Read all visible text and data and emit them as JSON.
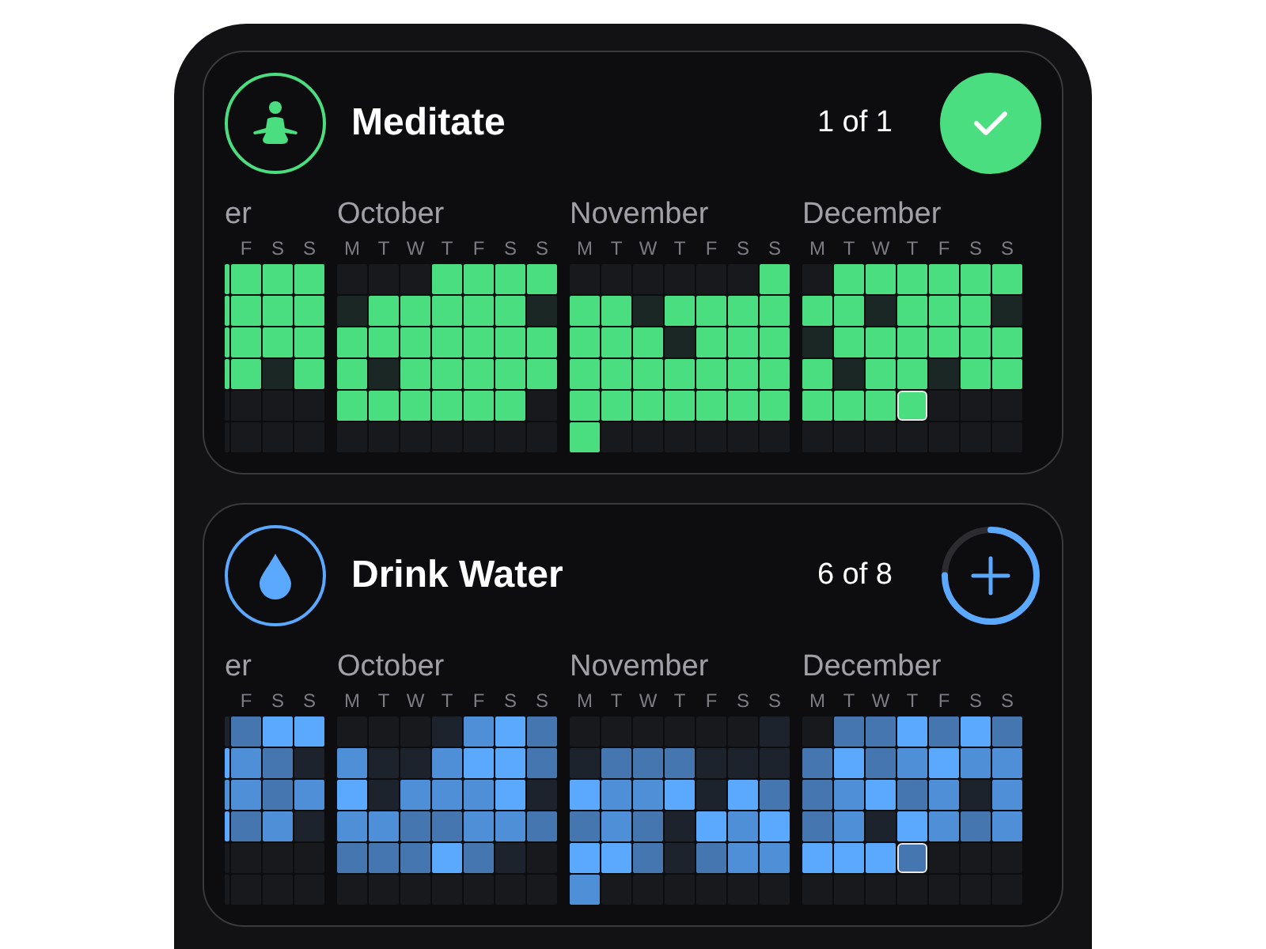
{
  "habits": [
    {
      "title": "Meditate",
      "count": "1 of 1",
      "completed": true,
      "color": "#4ade80",
      "months": [
        {
          "name": "er",
          "kind": "partial",
          "days": [
            "F",
            "S",
            "S"
          ],
          "weeks": [
            [
              {
                "kind": "done"
              },
              {
                "kind": "done"
              },
              {
                "kind": "done"
              },
              {
                "kind": "done"
              }
            ],
            [
              {
                "kind": "done"
              },
              {
                "kind": "done"
              },
              {
                "kind": "done"
              },
              {
                "kind": "done"
              }
            ],
            [
              {
                "kind": "done"
              },
              {
                "kind": "done"
              },
              {
                "kind": "done"
              },
              {
                "kind": "done"
              }
            ],
            [
              {
                "kind": "done"
              },
              {
                "kind": "done"
              },
              {
                "kind": "missed"
              },
              {
                "kind": "done"
              }
            ],
            [
              {
                "kind": "blank"
              },
              {
                "kind": "blank"
              },
              {
                "kind": "blank"
              },
              {
                "kind": "blank"
              }
            ],
            [
              {
                "kind": "blank"
              },
              {
                "kind": "blank"
              },
              {
                "kind": "blank"
              },
              {
                "kind": "blank"
              }
            ]
          ]
        },
        {
          "name": "October",
          "kind": "full",
          "days": [
            "M",
            "T",
            "W",
            "T",
            "F",
            "S",
            "S"
          ],
          "weeks": [
            [
              {
                "kind": "blank"
              },
              {
                "kind": "blank"
              },
              {
                "kind": "blank"
              },
              {
                "kind": "done"
              },
              {
                "kind": "done"
              },
              {
                "kind": "done"
              },
              {
                "kind": "done"
              }
            ],
            [
              {
                "kind": "missed"
              },
              {
                "kind": "done"
              },
              {
                "kind": "done"
              },
              {
                "kind": "done"
              },
              {
                "kind": "done"
              },
              {
                "kind": "done"
              },
              {
                "kind": "missed"
              }
            ],
            [
              {
                "kind": "done"
              },
              {
                "kind": "done"
              },
              {
                "kind": "done"
              },
              {
                "kind": "done"
              },
              {
                "kind": "done"
              },
              {
                "kind": "done"
              },
              {
                "kind": "done"
              }
            ],
            [
              {
                "kind": "done"
              },
              {
                "kind": "missed"
              },
              {
                "kind": "done"
              },
              {
                "kind": "done"
              },
              {
                "kind": "done"
              },
              {
                "kind": "done"
              },
              {
                "kind": "done"
              }
            ],
            [
              {
                "kind": "done"
              },
              {
                "kind": "done"
              },
              {
                "kind": "done"
              },
              {
                "kind": "done"
              },
              {
                "kind": "done"
              },
              {
                "kind": "done"
              },
              {
                "kind": "blank"
              }
            ],
            [
              {
                "kind": "blank"
              },
              {
                "kind": "blank"
              },
              {
                "kind": "blank"
              },
              {
                "kind": "blank"
              },
              {
                "kind": "blank"
              },
              {
                "kind": "blank"
              },
              {
                "kind": "blank"
              }
            ]
          ]
        },
        {
          "name": "November",
          "kind": "full",
          "days": [
            "M",
            "T",
            "W",
            "T",
            "F",
            "S",
            "S"
          ],
          "weeks": [
            [
              {
                "kind": "blank"
              },
              {
                "kind": "blank"
              },
              {
                "kind": "blank"
              },
              {
                "kind": "blank"
              },
              {
                "kind": "blank"
              },
              {
                "kind": "blank"
              },
              {
                "kind": "done"
              }
            ],
            [
              {
                "kind": "done"
              },
              {
                "kind": "done"
              },
              {
                "kind": "missed"
              },
              {
                "kind": "done"
              },
              {
                "kind": "done"
              },
              {
                "kind": "done"
              },
              {
                "kind": "done"
              }
            ],
            [
              {
                "kind": "done"
              },
              {
                "kind": "done"
              },
              {
                "kind": "done"
              },
              {
                "kind": "missed"
              },
              {
                "kind": "done"
              },
              {
                "kind": "done"
              },
              {
                "kind": "done"
              }
            ],
            [
              {
                "kind": "done"
              },
              {
                "kind": "done"
              },
              {
                "kind": "done"
              },
              {
                "kind": "done"
              },
              {
                "kind": "done"
              },
              {
                "kind": "done"
              },
              {
                "kind": "done"
              }
            ],
            [
              {
                "kind": "done"
              },
              {
                "kind": "done"
              },
              {
                "kind": "done"
              },
              {
                "kind": "done"
              },
              {
                "kind": "done"
              },
              {
                "kind": "done"
              },
              {
                "kind": "done"
              }
            ],
            [
              {
                "kind": "done"
              },
              {
                "kind": "blank"
              },
              {
                "kind": "blank"
              },
              {
                "kind": "blank"
              },
              {
                "kind": "blank"
              },
              {
                "kind": "blank"
              },
              {
                "kind": "blank"
              }
            ]
          ]
        },
        {
          "name": "December",
          "kind": "full",
          "days": [
            "M",
            "T",
            "W",
            "T",
            "F",
            "S",
            "S"
          ],
          "weeks": [
            [
              {
                "kind": "blank"
              },
              {
                "kind": "done"
              },
              {
                "kind": "done"
              },
              {
                "kind": "done"
              },
              {
                "kind": "done"
              },
              {
                "kind": "done"
              },
              {
                "kind": "done"
              }
            ],
            [
              {
                "kind": "done"
              },
              {
                "kind": "done"
              },
              {
                "kind": "missed"
              },
              {
                "kind": "done"
              },
              {
                "kind": "done"
              },
              {
                "kind": "done"
              },
              {
                "kind": "missed"
              }
            ],
            [
              {
                "kind": "missed"
              },
              {
                "kind": "done"
              },
              {
                "kind": "done"
              },
              {
                "kind": "done"
              },
              {
                "kind": "done"
              },
              {
                "kind": "done"
              },
              {
                "kind": "done"
              }
            ],
            [
              {
                "kind": "done"
              },
              {
                "kind": "missed"
              },
              {
                "kind": "done"
              },
              {
                "kind": "done"
              },
              {
                "kind": "missed"
              },
              {
                "kind": "done"
              },
              {
                "kind": "done"
              }
            ],
            [
              {
                "kind": "done"
              },
              {
                "kind": "done"
              },
              {
                "kind": "done"
              },
              {
                "kind": "done",
                "today": true
              },
              {
                "kind": "blank"
              },
              {
                "kind": "blank"
              },
              {
                "kind": "blank"
              }
            ],
            [
              {
                "kind": "blank"
              },
              {
                "kind": "blank"
              },
              {
                "kind": "blank"
              },
              {
                "kind": "blank"
              },
              {
                "kind": "blank"
              },
              {
                "kind": "blank"
              },
              {
                "kind": "blank"
              }
            ]
          ]
        }
      ]
    },
    {
      "title": "Drink Water",
      "count": "6 of 8",
      "completed": false,
      "color": "#5ba8ff",
      "months": [
        {
          "name": "er",
          "kind": "partial",
          "days": [
            "F",
            "S",
            "S"
          ],
          "weeks": [
            [
              {
                "kind": "missed"
              },
              {
                "kind": "done",
                "color": "#4676b0"
              },
              {
                "kind": "done",
                "color": "#5ba8ff"
              },
              {
                "kind": "done",
                "color": "#5ba8ff"
              }
            ],
            [
              {
                "kind": "done",
                "color": "#5ba8ff"
              },
              {
                "kind": "done",
                "color": "#4f8fd8"
              },
              {
                "kind": "done",
                "color": "#4676b0"
              },
              {
                "kind": "missed"
              }
            ],
            [
              {
                "kind": "done",
                "color": "#4f8fd8"
              },
              {
                "kind": "done",
                "color": "#4f8fd8"
              },
              {
                "kind": "done",
                "color": "#4676b0"
              },
              {
                "kind": "done",
                "color": "#4f8fd8"
              }
            ],
            [
              {
                "kind": "done",
                "color": "#5ba8ff"
              },
              {
                "kind": "done",
                "color": "#4676b0"
              },
              {
                "kind": "done",
                "color": "#4f8fd8"
              },
              {
                "kind": "missed"
              }
            ],
            [
              {
                "kind": "blank"
              },
              {
                "kind": "blank"
              },
              {
                "kind": "blank"
              },
              {
                "kind": "blank"
              }
            ],
            [
              {
                "kind": "blank"
              },
              {
                "kind": "blank"
              },
              {
                "kind": "blank"
              },
              {
                "kind": "blank"
              }
            ]
          ]
        },
        {
          "name": "October",
          "kind": "full",
          "days": [
            "M",
            "T",
            "W",
            "T",
            "F",
            "S",
            "S"
          ],
          "weeks": [
            [
              {
                "kind": "blank"
              },
              {
                "kind": "blank"
              },
              {
                "kind": "blank"
              },
              {
                "kind": "missed"
              },
              {
                "kind": "done",
                "color": "#4f8fd8"
              },
              {
                "kind": "done",
                "color": "#5ba8ff"
              },
              {
                "kind": "done",
                "color": "#4676b0"
              }
            ],
            [
              {
                "kind": "done",
                "color": "#4f8fd8"
              },
              {
                "kind": "missed"
              },
              {
                "kind": "missed"
              },
              {
                "kind": "done",
                "color": "#4f8fd8"
              },
              {
                "kind": "done",
                "color": "#5ba8ff"
              },
              {
                "kind": "done",
                "color": "#5ba8ff"
              },
              {
                "kind": "done",
                "color": "#4676b0"
              }
            ],
            [
              {
                "kind": "done",
                "color": "#5ba8ff"
              },
              {
                "kind": "missed"
              },
              {
                "kind": "done",
                "color": "#4f8fd8"
              },
              {
                "kind": "done",
                "color": "#4f8fd8"
              },
              {
                "kind": "done",
                "color": "#4f8fd8"
              },
              {
                "kind": "done",
                "color": "#5ba8ff"
              },
              {
                "kind": "missed"
              }
            ],
            [
              {
                "kind": "done",
                "color": "#4f8fd8"
              },
              {
                "kind": "done",
                "color": "#4f8fd8"
              },
              {
                "kind": "done",
                "color": "#4676b0"
              },
              {
                "kind": "done",
                "color": "#4676b0"
              },
              {
                "kind": "done",
                "color": "#4f8fd8"
              },
              {
                "kind": "done",
                "color": "#4f8fd8"
              },
              {
                "kind": "done",
                "color": "#4676b0"
              }
            ],
            [
              {
                "kind": "done",
                "color": "#4676b0"
              },
              {
                "kind": "done",
                "color": "#4676b0"
              },
              {
                "kind": "done",
                "color": "#4676b0"
              },
              {
                "kind": "done",
                "color": "#5ba8ff"
              },
              {
                "kind": "done",
                "color": "#4676b0"
              },
              {
                "kind": "missed"
              },
              {
                "kind": "blank"
              }
            ],
            [
              {
                "kind": "blank"
              },
              {
                "kind": "blank"
              },
              {
                "kind": "blank"
              },
              {
                "kind": "blank"
              },
              {
                "kind": "blank"
              },
              {
                "kind": "blank"
              },
              {
                "kind": "blank"
              }
            ]
          ]
        },
        {
          "name": "November",
          "kind": "full",
          "days": [
            "M",
            "T",
            "W",
            "T",
            "F",
            "S",
            "S"
          ],
          "weeks": [
            [
              {
                "kind": "blank"
              },
              {
                "kind": "blank"
              },
              {
                "kind": "blank"
              },
              {
                "kind": "blank"
              },
              {
                "kind": "blank"
              },
              {
                "kind": "blank"
              },
              {
                "kind": "missed"
              }
            ],
            [
              {
                "kind": "missed"
              },
              {
                "kind": "done",
                "color": "#4676b0"
              },
              {
                "kind": "done",
                "color": "#4676b0"
              },
              {
                "kind": "done",
                "color": "#4676b0"
              },
              {
                "kind": "missed"
              },
              {
                "kind": "missed"
              },
              {
                "kind": "missed"
              }
            ],
            [
              {
                "kind": "done",
                "color": "#5ba8ff"
              },
              {
                "kind": "done",
                "color": "#4f8fd8"
              },
              {
                "kind": "done",
                "color": "#4f8fd8"
              },
              {
                "kind": "done",
                "color": "#5ba8ff"
              },
              {
                "kind": "missed"
              },
              {
                "kind": "done",
                "color": "#5ba8ff"
              },
              {
                "kind": "done",
                "color": "#4676b0"
              }
            ],
            [
              {
                "kind": "done",
                "color": "#4676b0"
              },
              {
                "kind": "done",
                "color": "#4f8fd8"
              },
              {
                "kind": "done",
                "color": "#4676b0"
              },
              {
                "kind": "missed"
              },
              {
                "kind": "done",
                "color": "#5ba8ff"
              },
              {
                "kind": "done",
                "color": "#4f8fd8"
              },
              {
                "kind": "done",
                "color": "#5ba8ff"
              }
            ],
            [
              {
                "kind": "done",
                "color": "#5ba8ff"
              },
              {
                "kind": "done",
                "color": "#5ba8ff"
              },
              {
                "kind": "done",
                "color": "#4676b0"
              },
              {
                "kind": "missed"
              },
              {
                "kind": "done",
                "color": "#4676b0"
              },
              {
                "kind": "done",
                "color": "#4f8fd8"
              },
              {
                "kind": "done",
                "color": "#4f8fd8"
              }
            ],
            [
              {
                "kind": "done",
                "color": "#4f8fd8"
              },
              {
                "kind": "blank"
              },
              {
                "kind": "blank"
              },
              {
                "kind": "blank"
              },
              {
                "kind": "blank"
              },
              {
                "kind": "blank"
              },
              {
                "kind": "blank"
              }
            ]
          ]
        },
        {
          "name": "December",
          "kind": "full",
          "days": [
            "M",
            "T",
            "W",
            "T",
            "F",
            "S",
            "S"
          ],
          "weeks": [
            [
              {
                "kind": "blank"
              },
              {
                "kind": "done",
                "color": "#4676b0"
              },
              {
                "kind": "done",
                "color": "#4676b0"
              },
              {
                "kind": "done",
                "color": "#5ba8ff"
              },
              {
                "kind": "done",
                "color": "#4676b0"
              },
              {
                "kind": "done",
                "color": "#5ba8ff"
              },
              {
                "kind": "done",
                "color": "#4676b0"
              }
            ],
            [
              {
                "kind": "done",
                "color": "#4676b0"
              },
              {
                "kind": "done",
                "color": "#5ba8ff"
              },
              {
                "kind": "done",
                "color": "#4676b0"
              },
              {
                "kind": "done",
                "color": "#4f8fd8"
              },
              {
                "kind": "done",
                "color": "#5ba8ff"
              },
              {
                "kind": "done",
                "color": "#4f8fd8"
              },
              {
                "kind": "done",
                "color": "#4f8fd8"
              }
            ],
            [
              {
                "kind": "done",
                "color": "#4676b0"
              },
              {
                "kind": "done",
                "color": "#4f8fd8"
              },
              {
                "kind": "done",
                "color": "#5ba8ff"
              },
              {
                "kind": "done",
                "color": "#4676b0"
              },
              {
                "kind": "done",
                "color": "#4f8fd8"
              },
              {
                "kind": "missed"
              },
              {
                "kind": "done",
                "color": "#4f8fd8"
              }
            ],
            [
              {
                "kind": "done",
                "color": "#4676b0"
              },
              {
                "kind": "done",
                "color": "#4f8fd8"
              },
              {
                "kind": "missed"
              },
              {
                "kind": "done",
                "color": "#5ba8ff"
              },
              {
                "kind": "done",
                "color": "#4f8fd8"
              },
              {
                "kind": "done",
                "color": "#4676b0"
              },
              {
                "kind": "done",
                "color": "#4f8fd8"
              }
            ],
            [
              {
                "kind": "done",
                "color": "#5ba8ff"
              },
              {
                "kind": "done",
                "color": "#5ba8ff"
              },
              {
                "kind": "done",
                "color": "#5ba8ff"
              },
              {
                "kind": "done",
                "color": "#4676b0",
                "today": true
              },
              {
                "kind": "blank"
              },
              {
                "kind": "blank"
              },
              {
                "kind": "blank"
              }
            ],
            [
              {
                "kind": "blank"
              },
              {
                "kind": "blank"
              },
              {
                "kind": "blank"
              },
              {
                "kind": "blank"
              },
              {
                "kind": "blank"
              },
              {
                "kind": "blank"
              },
              {
                "kind": "blank"
              }
            ]
          ]
        }
      ]
    }
  ]
}
